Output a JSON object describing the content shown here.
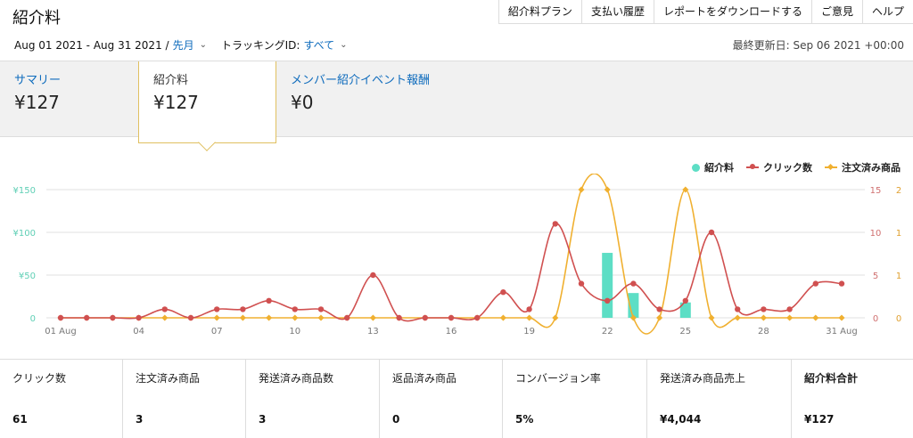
{
  "page": {
    "title": "紹介料"
  },
  "topnav": [
    "紹介料プラン",
    "支払い履歴",
    "レポートをダウンロードする",
    "ご意見",
    "ヘルプ"
  ],
  "filters": {
    "date_range": "Aug 01 2021 - Aug 31 2021 /",
    "period_link": "先月",
    "tracking_label": "トラッキングID:",
    "tracking_link": "すべて"
  },
  "updated": "最終更新日: Sep 06 2021 +00:00",
  "tabs": [
    {
      "label": "サマリー",
      "value": "¥127"
    },
    {
      "label": "紹介料",
      "value": "¥127"
    },
    {
      "label": "メンバー紹介イベント報酬",
      "value": "¥0"
    }
  ],
  "legend": [
    {
      "name": "紹介料",
      "color": "#5ddec5"
    },
    {
      "name": "クリック数",
      "color": "#d05050"
    },
    {
      "name": "注文済み商品",
      "color": "#f0b030"
    }
  ],
  "chart_data": {
    "type": "line",
    "x_tick_labels": [
      "01 Aug",
      "04",
      "07",
      "10",
      "13",
      "16",
      "19",
      "22",
      "25",
      "28",
      "31 Aug"
    ],
    "x": [
      1,
      2,
      3,
      4,
      5,
      6,
      7,
      8,
      9,
      10,
      11,
      12,
      13,
      14,
      15,
      16,
      17,
      18,
      19,
      20,
      21,
      22,
      23,
      24,
      25,
      26,
      27,
      28,
      29,
      30,
      31
    ],
    "y_left_ticks": [
      "¥150",
      "¥100",
      "¥50",
      "0"
    ],
    "y_left_range": [
      0,
      150
    ],
    "y_right1_ticks": [
      "15",
      "10",
      "5",
      "0"
    ],
    "y_right1_range": [
      0,
      15
    ],
    "y_right2_ticks": [
      "2",
      "1",
      "1",
      "0"
    ],
    "y_right2_range": [
      0,
      2
    ],
    "grid": true,
    "legend_position": "top-right",
    "series": [
      {
        "name": "紹介料",
        "type": "bar",
        "axis": "left",
        "color": "#5ddec5",
        "values": [
          0,
          0,
          0,
          0,
          0,
          0,
          0,
          0,
          0,
          0,
          0,
          0,
          0,
          0,
          0,
          0,
          0,
          0,
          0,
          0,
          0,
          76,
          29,
          0,
          18,
          0,
          0,
          0,
          0,
          0,
          0
        ]
      },
      {
        "name": "クリック数",
        "type": "line",
        "axis": "right1",
        "color": "#d05050",
        "values": [
          0,
          0,
          0,
          0,
          1,
          0,
          1,
          1,
          2,
          1,
          1,
          0,
          5,
          0,
          0,
          0,
          0,
          3,
          1,
          11,
          4,
          2,
          4,
          1,
          2,
          10,
          1,
          1,
          1,
          4,
          4
        ]
      },
      {
        "name": "注文済み商品",
        "type": "line",
        "axis": "right2",
        "color": "#f0b030",
        "values": [
          0,
          0,
          0,
          0,
          0,
          0,
          0,
          0,
          0,
          0,
          0,
          0,
          0,
          0,
          0,
          0,
          0,
          0,
          0,
          0,
          2,
          2,
          0,
          0,
          2,
          0,
          0,
          0,
          0,
          0,
          0
        ]
      }
    ]
  },
  "stats": [
    {
      "label": "クリック数",
      "value": "61"
    },
    {
      "label": "注文済み商品",
      "value": "3"
    },
    {
      "label": "発送済み商品数",
      "value": "3"
    },
    {
      "label": "返品済み商品",
      "value": "0"
    },
    {
      "label": "コンバージョン率",
      "value": "5%"
    },
    {
      "label": "発送済み商品売上",
      "value": "¥4,044"
    },
    {
      "label": "紹介料合計",
      "value": "¥127"
    }
  ]
}
